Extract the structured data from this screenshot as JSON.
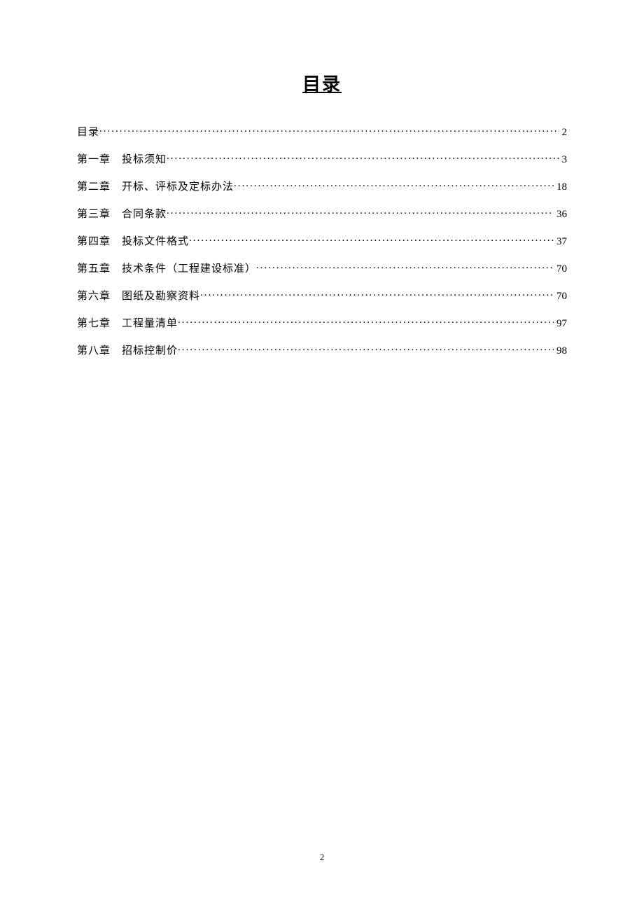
{
  "title": "目录",
  "toc": [
    {
      "label": "目录",
      "page": "2"
    },
    {
      "label": "第一章　投标须知",
      "page": "3"
    },
    {
      "label": "第二章　开标、评标及定标办法",
      "page": "18"
    },
    {
      "label": "第三章　合同条款",
      "page": "36"
    },
    {
      "label": "第四章　投标文件格式",
      "page": "37"
    },
    {
      "label": "第五章　技术条件（工程建设标准）",
      "page": "70"
    },
    {
      "label": "第六章　图纸及勘察资料",
      "page": "70"
    },
    {
      "label": "第七章　工程量清单",
      "page": "97"
    },
    {
      "label": "第八章　招标控制价",
      "page": "98"
    }
  ],
  "page_number": "2"
}
